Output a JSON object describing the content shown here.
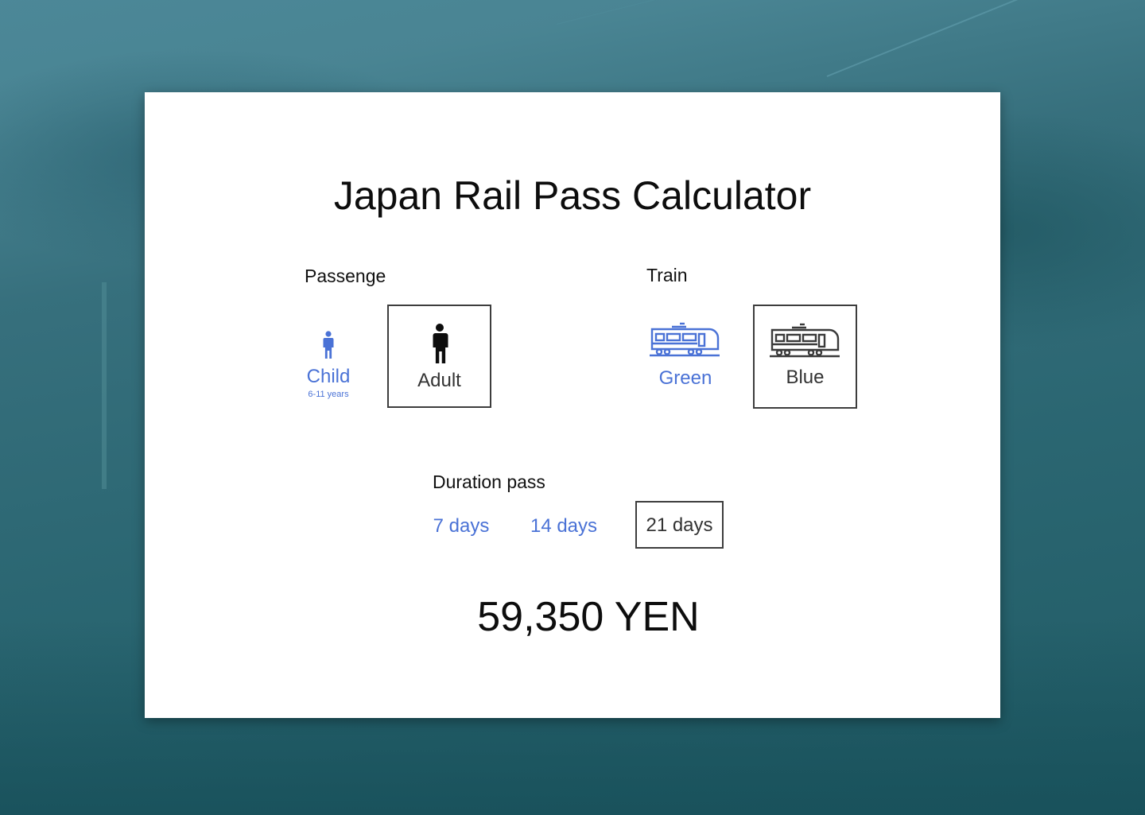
{
  "title": "Japan Rail Pass Calculator",
  "passenger": {
    "label": "Passenge",
    "options": [
      {
        "label": "Child",
        "sub": "6-11 years",
        "icon": "person-icon",
        "selected": false
      },
      {
        "label": "Adult",
        "icon": "person-icon",
        "selected": true
      }
    ]
  },
  "train": {
    "label": "Train",
    "options": [
      {
        "label": "Green",
        "icon": "train-icon",
        "selected": false
      },
      {
        "label": "Blue",
        "icon": "train-icon",
        "selected": true
      }
    ]
  },
  "duration": {
    "label": "Duration pass",
    "options": [
      {
        "label": "7 days",
        "selected": false
      },
      {
        "label": "14 days",
        "selected": false
      },
      {
        "label": "21 days",
        "selected": true
      }
    ]
  },
  "price": "59,350 YEN",
  "colors": {
    "accent": "#4a72d6",
    "selected_border": "#3d3d3d",
    "text": "#0d0d0d"
  }
}
